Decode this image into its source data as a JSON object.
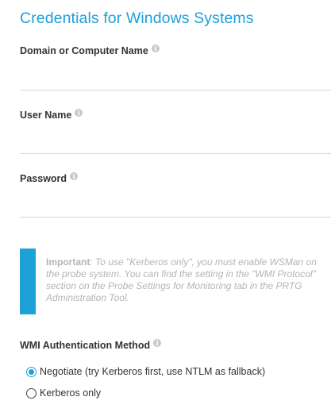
{
  "section": {
    "title": "Credentials for Windows Systems"
  },
  "fields": {
    "domain": {
      "label": "Domain or Computer Name",
      "value": "",
      "placeholder": ""
    },
    "username": {
      "label": "User Name",
      "value": "",
      "placeholder": ""
    },
    "password": {
      "label": "Password",
      "value": "",
      "placeholder": ""
    }
  },
  "note": {
    "strong": "Important",
    "text": ": To use \"Kerberos only\", you must enable WSMan on the probe system. You can find the setting in the \"WMI Protocol\" section on the Probe Settings for Monitoring tab in the PRTG Administration Tool."
  },
  "wmi_auth": {
    "label": "WMI Authentication Method",
    "options": [
      {
        "label": "Negotiate (try Kerberos first, use NTLM as fallback)",
        "selected": true
      },
      {
        "label": "Kerberos only",
        "selected": false
      }
    ]
  },
  "icons": {
    "info": "info-icon",
    "info_glyph": "i"
  },
  "colors": {
    "accent": "#1ea0d9",
    "note_text": "#b4b4b4",
    "info_icon": "#c9c9c9"
  }
}
